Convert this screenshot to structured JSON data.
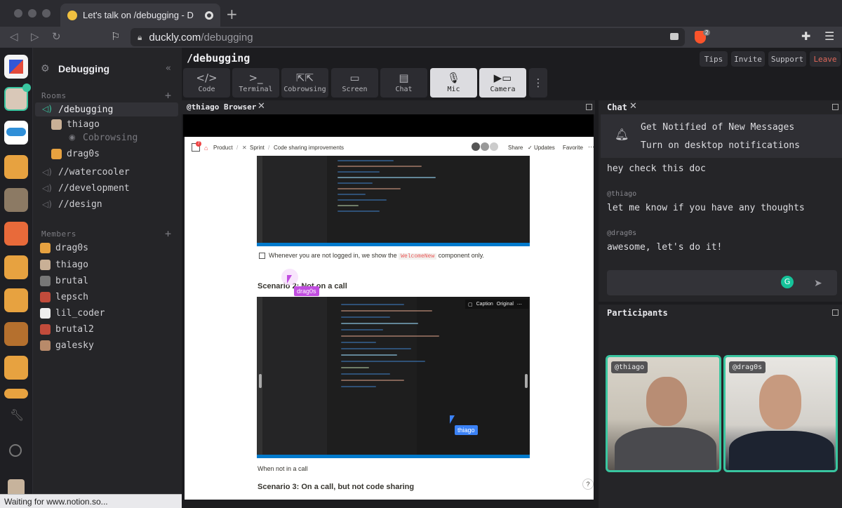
{
  "browser": {
    "tab_title": "Let's talk on /debugging - D",
    "new_tab": "+",
    "url_domain": "duckly.com",
    "url_path": "/debugging",
    "extension_count": "2"
  },
  "sidebar": {
    "title": "Debugging",
    "rooms_label": "Rooms",
    "members_label": "Members",
    "rooms": [
      {
        "label": "/debugging"
      },
      {
        "label": "//watercooler"
      },
      {
        "label": "//development"
      },
      {
        "label": "//design"
      }
    ],
    "room_users": {
      "user1": "thiago",
      "user1_activity": "Cobrowsing",
      "user2": "drag0s"
    },
    "members": [
      "drag0s",
      "thiago",
      "brutal",
      "lepsch",
      "lil_coder",
      "brutal2",
      "galesky"
    ],
    "status": "Waiting for www.notion.so..."
  },
  "header": {
    "room_title": "/debugging",
    "buttons": {
      "tips": "Tips",
      "invite": "Invite",
      "support": "Support",
      "leave": "Leave"
    }
  },
  "toolbar": [
    {
      "icon": "code-icon",
      "label": "Code"
    },
    {
      "icon": "terminal-icon",
      "label": "Terminal"
    },
    {
      "icon": "cobrowsing-icon",
      "label": "Cobrowsing"
    },
    {
      "icon": "screen-icon",
      "label": "Screen"
    },
    {
      "icon": "chat-icon",
      "label": "Chat"
    },
    {
      "icon": "mic-icon",
      "label": "Mic"
    },
    {
      "icon": "camera-icon",
      "label": "Camera"
    }
  ],
  "browser_panel": {
    "title": "@thiago Browser",
    "breadcrumb": [
      "Product",
      "Sprint",
      "Code sharing improvements"
    ],
    "notif_badge": "7",
    "page_actions": {
      "share": "Share",
      "updates": "Updates",
      "favorite": "Favorite"
    },
    "checkbox_text_before": "Whenever you are not logged in, we show the",
    "checkbox_code": "WelcomeNew",
    "checkbox_text_after": "component only.",
    "scenario2": "Scenario 2: Not on a call",
    "caption_btn": "Caption",
    "original_btn": "Original",
    "caption_below": "When not in a call",
    "scenario3": "Scenario 3: On a call, but not code sharing",
    "cursor1": "drag0s",
    "cursor2": "thiago",
    "help": "?"
  },
  "chat": {
    "title": "Chat",
    "notify_title": "Get Notified of New Messages",
    "notify_sub": "Turn on desktop notifications",
    "messages": [
      {
        "user": "",
        "text": "hey check this doc"
      },
      {
        "user": "@thiago",
        "text": "let me know if you have any thoughts"
      },
      {
        "user": "@drag0s",
        "text": "awesome, let's do it!"
      }
    ]
  },
  "participants": {
    "title": "Participants",
    "people": [
      "@thiago",
      "@drag0s"
    ]
  },
  "colors": {
    "accent": "#39c6a0",
    "cursor": "#c14de0",
    "cursor2": "#3b82f6",
    "leave": "#e0685a"
  }
}
